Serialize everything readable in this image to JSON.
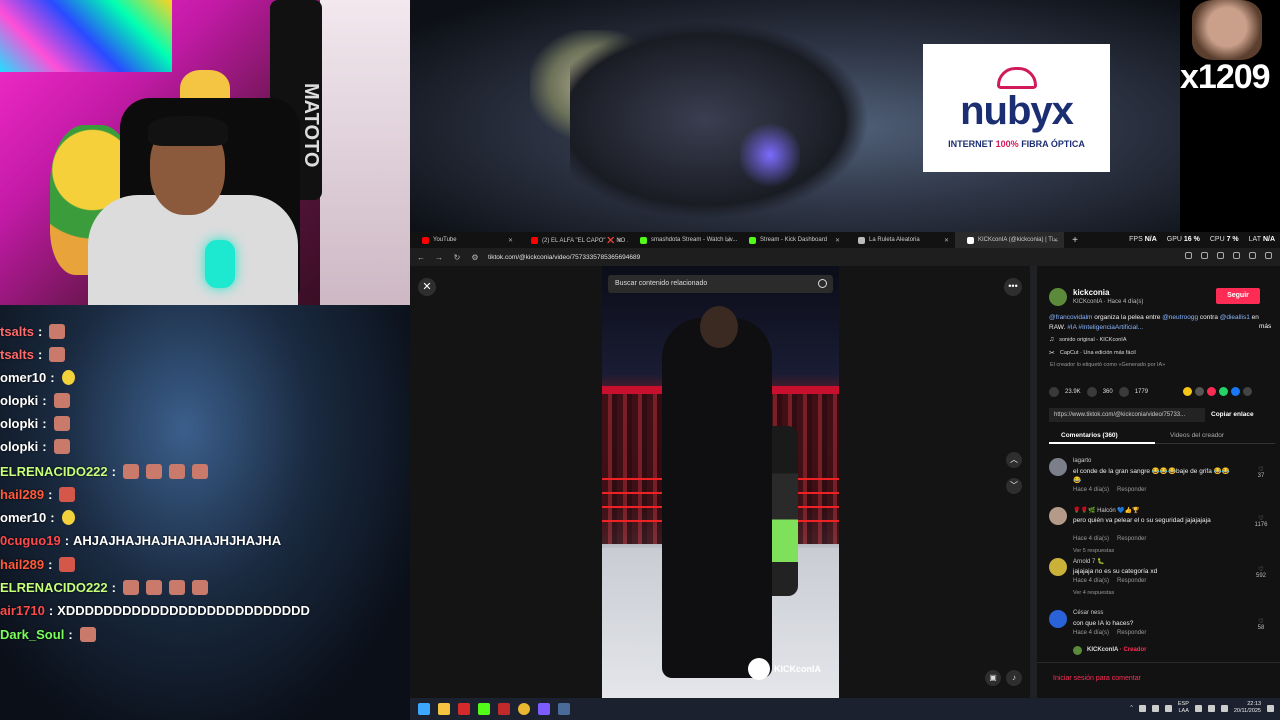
{
  "webcam": {
    "bag_text": "MATOTO"
  },
  "chat": [
    {
      "user": "tsalts",
      "color": "#ff6a6a",
      "emotes": [
        "e1"
      ],
      "msg": ""
    },
    {
      "user": "tsalts",
      "color": "#ff6a6a",
      "emotes": [
        "e1"
      ],
      "msg": ""
    },
    {
      "user": "omer10",
      "color": "#ffffff",
      "emotes": [
        "duck"
      ],
      "msg": ""
    },
    {
      "user": "olopki",
      "color": "#ffffff",
      "emotes": [
        "e1"
      ],
      "msg": ""
    },
    {
      "user": "olopki",
      "color": "#ffffff",
      "emotes": [
        "e1"
      ],
      "msg": ""
    },
    {
      "user": "olopki",
      "color": "#ffffff",
      "emotes": [
        "e1"
      ],
      "msg": ""
    },
    {
      "user": "ELRENACIDO222",
      "color": "#c6ff7a",
      "emotes": [
        "e1",
        "e1",
        "e1",
        "e1"
      ],
      "msg": ""
    },
    {
      "user": "hail289",
      "color": "#ff5a3a",
      "emotes": [
        "e2"
      ],
      "msg": ""
    },
    {
      "user": "omer10",
      "color": "#ffffff",
      "emotes": [
        "duck"
      ],
      "msg": ""
    },
    {
      "user": "0cuguo19",
      "color": "#ff4a4a",
      "emotes": [],
      "msg": "AHJAJHAJHAJHAJHAJHJHAJHA"
    },
    {
      "user": "hail289",
      "color": "#ff5a3a",
      "emotes": [
        "e2"
      ],
      "msg": ""
    },
    {
      "user": "ELRENACIDO222",
      "color": "#c6ff7a",
      "emotes": [
        "e1",
        "e1",
        "e1",
        "e1"
      ],
      "msg": ""
    },
    {
      "user": "air1710",
      "color": "#ff4a4a",
      "emotes": [],
      "msg": "XDDDDDDDDDDDDDDDDDDDDDDDDDD"
    },
    {
      "user": "Dark_Soul",
      "color": "#7aff5a",
      "emotes": [
        "e1"
      ],
      "msg": ""
    }
  ],
  "ad": {
    "brand": "nubyx",
    "tag_prefix": "INTERNET ",
    "tag_highlight": "100%",
    "tag_suffix": " FIBRA ÓPTICA"
  },
  "meme": {
    "text": "x1209"
  },
  "browser": {
    "tabs": [
      {
        "title": "YouTube",
        "fav": "#ff0000"
      },
      {
        "title": "(2) EL ALFA \"EL CAPO\" ❌ NO ...",
        "fav": "#ff0000"
      },
      {
        "title": "smashdota Stream - Watch Liv...",
        "fav": "#53fc18"
      },
      {
        "title": "Stream - Kick Dashboard",
        "fav": "#53fc18"
      },
      {
        "title": "La Ruleta Aleatoria",
        "fav": "#bbbbbb"
      },
      {
        "title": "KICKconIA (@kickconia) | Ti...",
        "fav": "#ffffff"
      }
    ],
    "perf": {
      "fps_label": "FPS",
      "fps": "N/A",
      "gpu_label": "GPU",
      "gpu": "16 %",
      "cpu_label": "CPU",
      "cpu": "7 %",
      "lat_label": "LAT",
      "lat": "N/A"
    },
    "url": "tiktok.com/@kickconia/video/7573335785365694689"
  },
  "video": {
    "search_placeholder": "Buscar contenido relacionado",
    "watermark": "KICKconIA"
  },
  "side": {
    "name": "kickconia",
    "sub": "KICKconIA · Hace 4 día(s)",
    "follow": "Seguir",
    "desc_mention1": "@francovidalm",
    "desc_t1": " organiza la pelea entre ",
    "desc_mention2": "@neutroogg",
    "desc_t2": " contra ",
    "desc_mention3": "@dieallis1",
    "desc_t3": " en RAW. ",
    "desc_tags": "#IA #InteligenciaArtificial...",
    "more": "más",
    "sound": "sonido original - KICKconIA",
    "capcut": "CapCut · Una edición más fácil",
    "ai_label": "El creador lo etiquetó como «Generado por IA»",
    "likes": "23.9K",
    "comments_count": "360",
    "saves": "1779",
    "link": "https://www.tiktok.com/@kickconia/video/75733...",
    "copy": "Copiar enlace",
    "tab_comments": "Comentarios (360)",
    "tab_videos": "Videos del creador",
    "comments": [
      {
        "user": "lagarto",
        "text": "el conde de la gran sangre 😂😂😂baje de grifa 😂😂😂",
        "time": "Hace 4 día(s)",
        "reply": "Responder",
        "likes": "37",
        "replies": "",
        "avatar": "#7a7f8a"
      },
      {
        "user": "🌹🌹🌿 Halcón 💙👍🏆",
        "text": "pero quién va pelear el o su seguridad jajajajaja",
        "time": "Hace 4 día(s)",
        "reply": "Responder",
        "likes": "1176",
        "replies": "Ver 5 respuestas",
        "avatar": "#b59a8a"
      },
      {
        "user": "Arnold 7 🐛",
        "text": "jajajaja no es su categoría xd",
        "time": "Hace 4 día(s)",
        "reply": "Responder",
        "likes": "592",
        "replies": "Ver 4 respuestas",
        "avatar": "#c9b13a"
      },
      {
        "user": "César ness",
        "text": "con que IA lo haces?",
        "time": "Hace 4 día(s)",
        "reply": "Responder",
        "likes": "58",
        "replies": "",
        "avatar": "#2a62d8"
      }
    ],
    "creator_reply_name": "KICKconIA",
    "creator_reply_tag": " · Creador",
    "login": "Iniciar sesión para comentar"
  },
  "taskbar": {
    "lang": "ESP",
    "lang2": "LAA",
    "time": "22:13",
    "date": "20/11/2025"
  }
}
